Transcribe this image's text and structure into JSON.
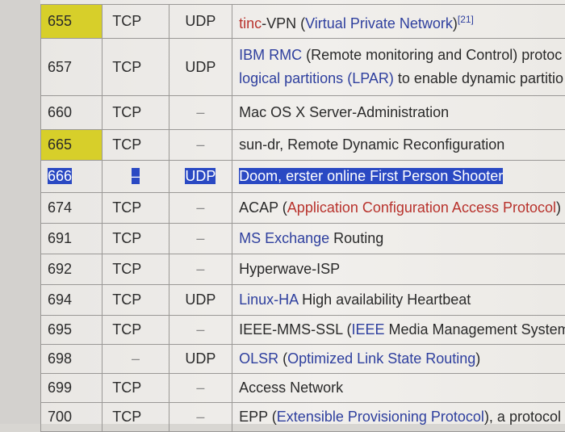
{
  "colors": {
    "highlight_yellow": "#d7cf2a",
    "selection_blue": "#2a49c3",
    "link_blue": "#2e3f9e",
    "link_red": "#b8322c"
  },
  "rows": [
    {
      "port": "655",
      "tcp": "TCP",
      "udp": "UDP",
      "highlight": true,
      "h": 42,
      "desc": [
        [
          [
            "tinc",
            "red"
          ],
          [
            "-VPN (",
            ""
          ],
          [
            "Virtual Private Network",
            "link"
          ],
          [
            ")",
            ""
          ],
          [
            "[21]",
            "sup link"
          ]
        ]
      ]
    },
    {
      "port": "657",
      "tcp": "TCP",
      "udp": "UDP",
      "h": 71,
      "desc": [
        [
          [
            "IBM RMC",
            "link"
          ],
          [
            " (Remote monitoring and Control) protoc",
            ""
          ]
        ],
        [
          [
            "logical partitions",
            "link"
          ],
          [
            " ",
            ""
          ],
          [
            "(LPAR)",
            "link"
          ],
          [
            " to enable dynamic partitio",
            ""
          ]
        ]
      ]
    },
    {
      "port": "660",
      "tcp": "TCP",
      "udp": "–",
      "h": 42,
      "desc": [
        [
          [
            "Mac OS X Server-Administration",
            ""
          ]
        ]
      ]
    },
    {
      "port": "665",
      "tcp": "TCP",
      "udp": "–",
      "highlight": true,
      "h": 38,
      "desc": [
        [
          [
            "sun-dr, Remote Dynamic Reconfiguration",
            ""
          ]
        ]
      ]
    },
    {
      "port": "666",
      "tcp": "–",
      "udp": "UDP",
      "selected": true,
      "h": 40,
      "desc": [
        [
          [
            "Doom, erster online First Person Shooter",
            "sel"
          ]
        ]
      ]
    },
    {
      "port": "674",
      "tcp": "TCP",
      "udp": "–",
      "h": 38,
      "desc": [
        [
          [
            "ACAP (",
            ""
          ],
          [
            "Application Configuration Access Protocol",
            "red"
          ],
          [
            ")",
            ""
          ]
        ]
      ]
    },
    {
      "port": "691",
      "tcp": "TCP",
      "udp": "–",
      "h": 38,
      "desc": [
        [
          [
            "MS Exchange",
            "link"
          ],
          [
            " Routing",
            ""
          ]
        ]
      ]
    },
    {
      "port": "692",
      "tcp": "TCP",
      "udp": "–",
      "h": 38,
      "desc": [
        [
          [
            "Hyperwave-ISP",
            ""
          ]
        ]
      ]
    },
    {
      "port": "694",
      "tcp": "TCP",
      "udp": "UDP",
      "h": 38,
      "desc": [
        [
          [
            "Linux-HA",
            "link"
          ],
          [
            " High availability Heartbeat",
            ""
          ]
        ]
      ]
    },
    {
      "port": "695",
      "tcp": "TCP",
      "udp": "–",
      "h": 36,
      "desc": [
        [
          [
            "IEEE-MMS-SSL (",
            ""
          ],
          [
            "IEEE",
            "link"
          ],
          [
            " Media Management System o",
            ""
          ]
        ]
      ]
    },
    {
      "port": "698",
      "tcp": "–",
      "udp": "UDP",
      "h": 36,
      "desc": [
        [
          [
            "OLSR",
            "link"
          ],
          [
            " (",
            ""
          ],
          [
            "Optimized Link State Routing",
            "link"
          ],
          [
            ")",
            ""
          ]
        ]
      ]
    },
    {
      "port": "699",
      "tcp": "TCP",
      "udp": "–",
      "h": 36,
      "desc": [
        [
          [
            "Access Network",
            ""
          ]
        ]
      ]
    },
    {
      "port": "700",
      "tcp": "TCP",
      "udp": "–",
      "h": 36,
      "desc": [
        [
          [
            "EPP (",
            ""
          ],
          [
            "Extensible Provisioning Protocol",
            "link"
          ],
          [
            "), a protocol for",
            ""
          ]
        ]
      ]
    }
  ]
}
